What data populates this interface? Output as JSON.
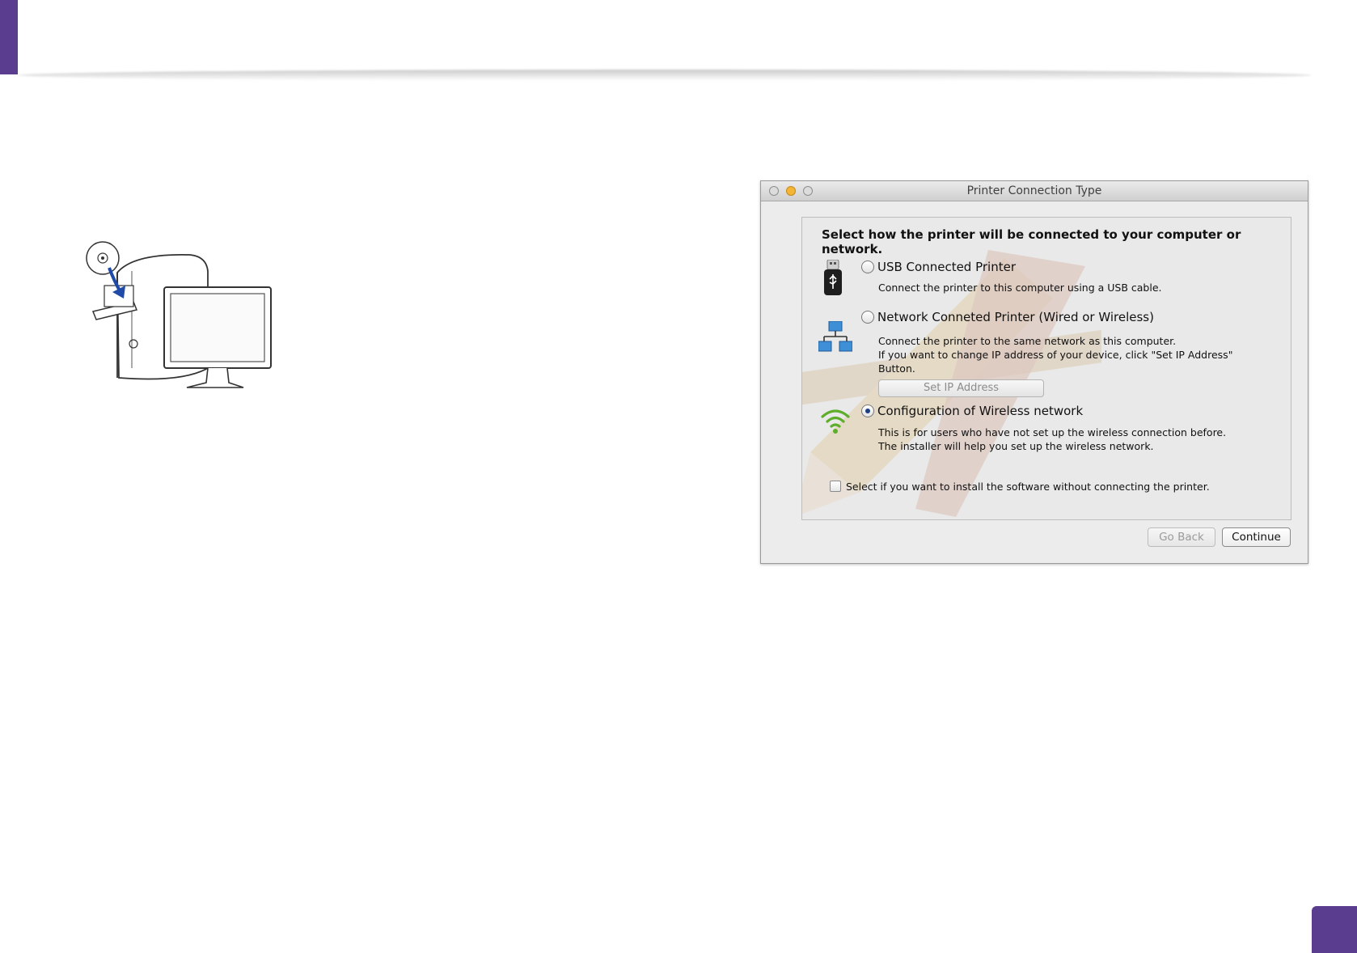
{
  "dialog": {
    "title": "Printer Connection Type",
    "heading": "Select how the printer will be connected to your computer or network.",
    "options": [
      {
        "title": "USB Connected Printer",
        "description": [
          "Connect the printer to this computer using a USB cable."
        ],
        "icon": "usb-icon",
        "selected": false
      },
      {
        "title": "Network Conneted Printer (Wired or Wireless)",
        "description": [
          "Connect the printer to the same network as this computer.",
          "If you want to change IP address of your device, click \"Set IP Address\"",
          "Button."
        ],
        "icon": "network-icon",
        "selected": false
      },
      {
        "title": "Configuration of Wireless network",
        "description": [
          "This is for users who have not set up the wireless connection before.",
          "The installer will help you set up the wireless network."
        ],
        "icon": "wifi-icon",
        "selected": true
      }
    ],
    "set_ip_button": "Set IP Address",
    "checkbox_label": "Select if you want to install the software without connecting the printer.",
    "checkbox_checked": false,
    "go_back_button": "Go Back",
    "continue_button": "Continue"
  },
  "colors": {
    "accent_purple": "#5a3d8f",
    "wifi_green": "#5fae2b",
    "network_blue": "#3f8fd6"
  }
}
